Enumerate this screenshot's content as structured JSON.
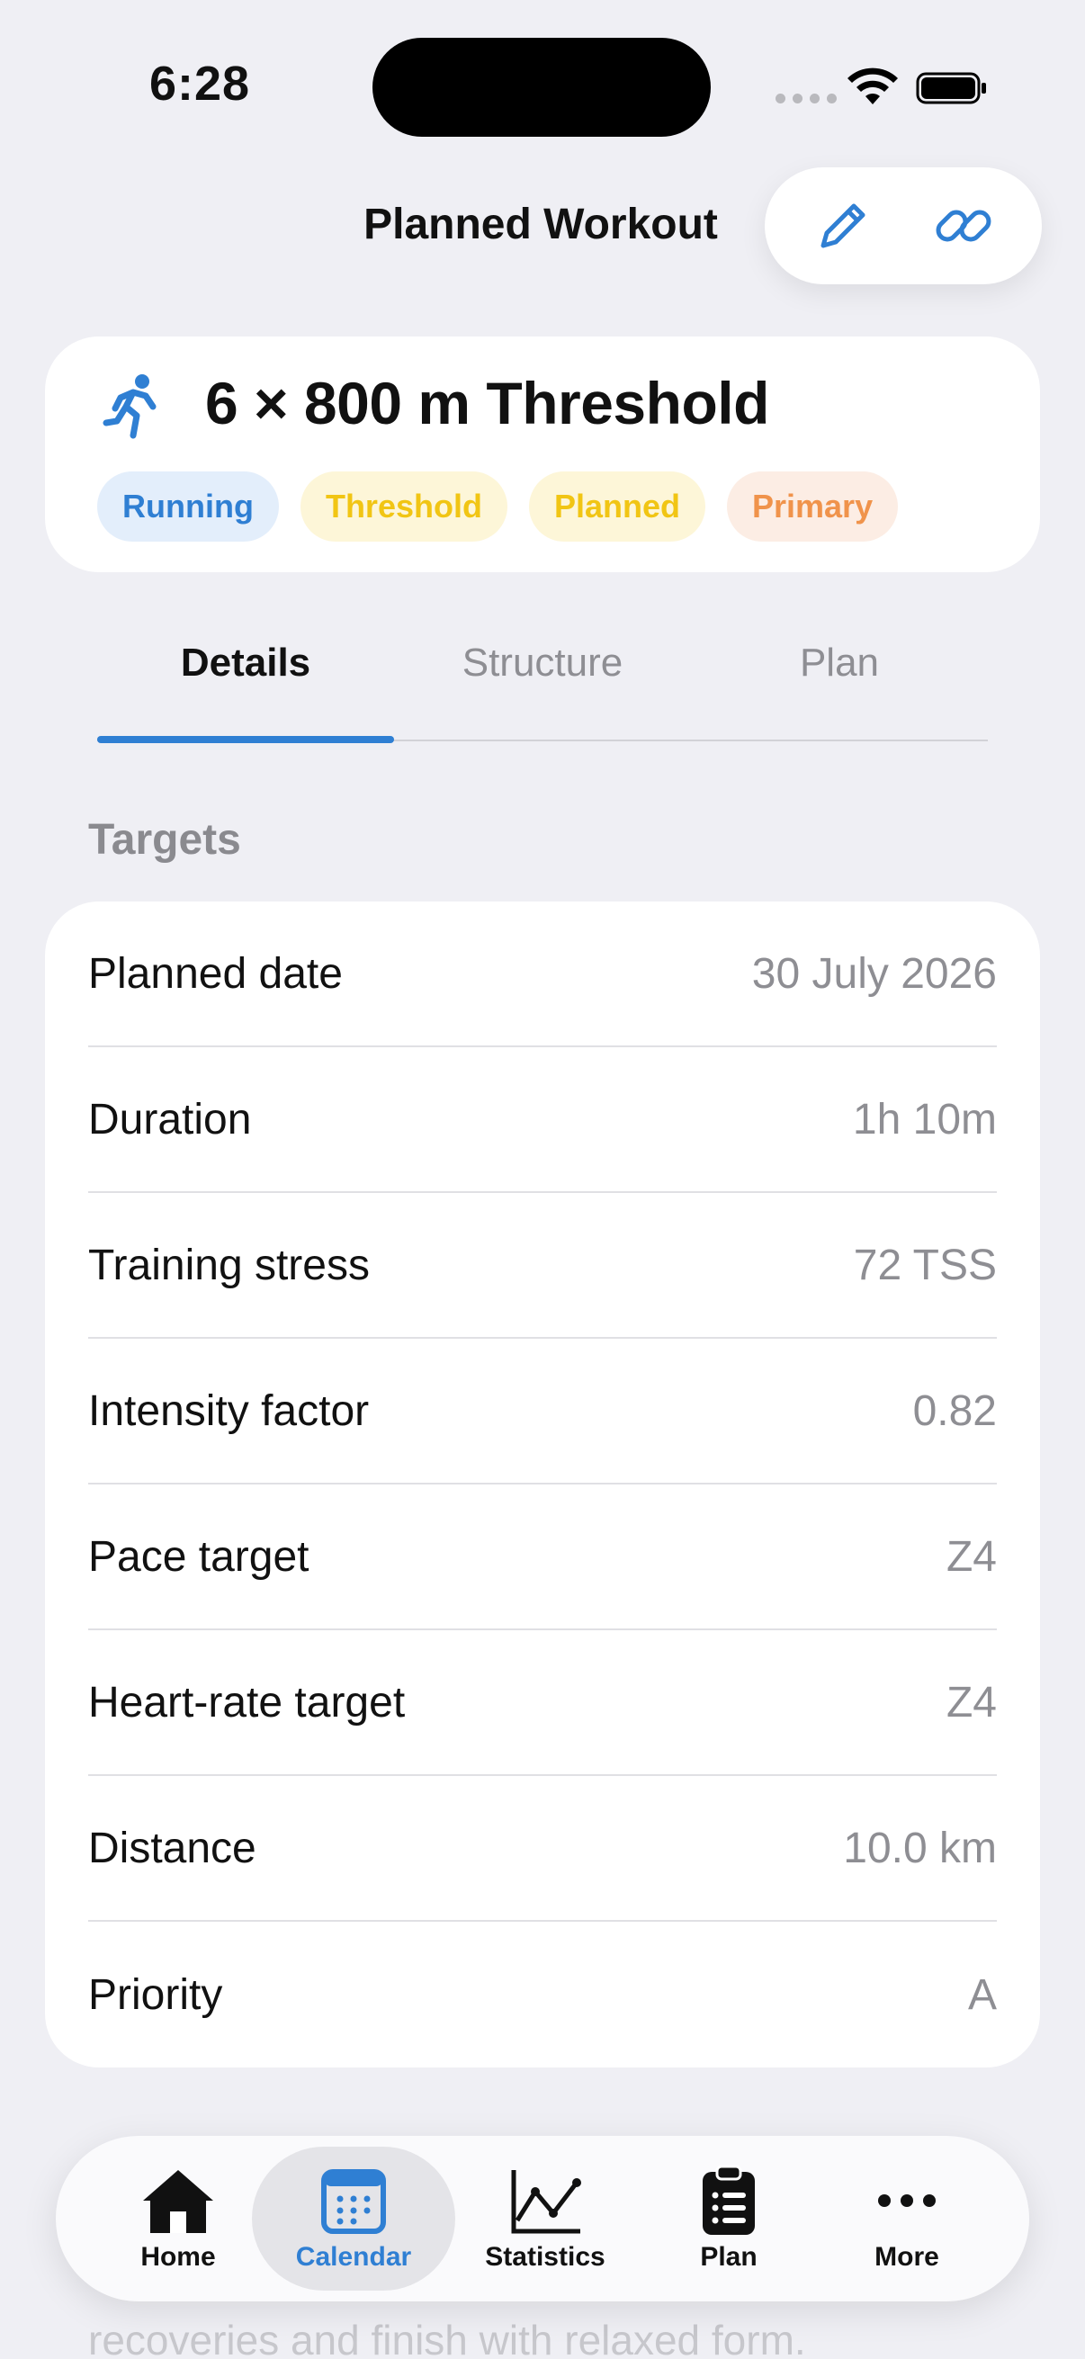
{
  "status_bar": {
    "time": "6:28"
  },
  "nav": {
    "title": "Planned Workout",
    "edit_icon": "pencil-icon",
    "link_icon": "link-icon"
  },
  "workout": {
    "icon": "running-person-icon",
    "title": "6 × 800 m Threshold",
    "chips": [
      "Running",
      "Threshold",
      "Planned",
      "Primary"
    ]
  },
  "tabs": [
    {
      "label": "Details",
      "active": true
    },
    {
      "label": "Structure",
      "active": false
    },
    {
      "label": "Plan",
      "active": false
    }
  ],
  "targets": {
    "section_label": "Targets",
    "rows": [
      {
        "label": "Planned date",
        "value": "30 July 2026"
      },
      {
        "label": "Duration",
        "value": "1h 10m"
      },
      {
        "label": "Training stress",
        "value": "72 TSS"
      },
      {
        "label": "Intensity factor",
        "value": "0.82"
      },
      {
        "label": "Pace target",
        "value": "Z4"
      },
      {
        "label": "Heart-rate target",
        "value": "Z4"
      },
      {
        "label": "Distance",
        "value": "10.0 km"
      },
      {
        "label": "Priority",
        "value": "A"
      }
    ]
  },
  "faded": {
    "line1": "recoveries and finish with relaxed form."
  },
  "tabbar": [
    {
      "label": "Home",
      "icon": "house-icon"
    },
    {
      "label": "Calendar",
      "icon": "calendar-icon",
      "active": true
    },
    {
      "label": "Statistics",
      "icon": "chart-line-icon"
    },
    {
      "label": "Plan",
      "icon": "clipboard-list-icon"
    },
    {
      "label": "More",
      "icon": "ellipsis-icon"
    }
  ],
  "colors": {
    "accent": "#2f7fd3",
    "background": "#efeff4"
  }
}
